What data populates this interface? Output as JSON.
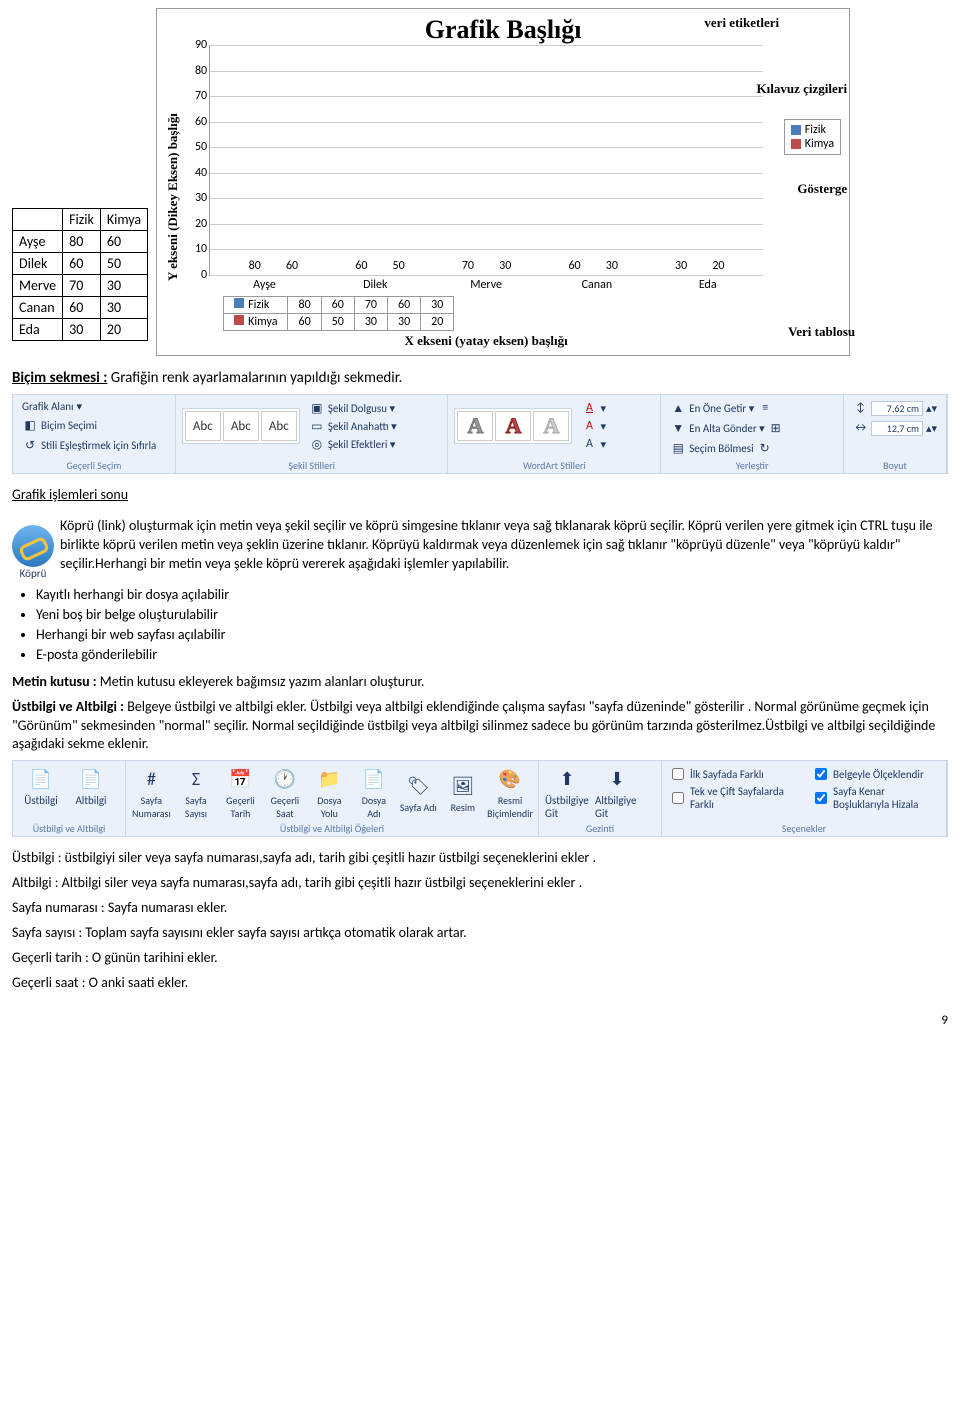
{
  "chart_data": {
    "type": "bar",
    "categories": [
      "Ayşe",
      "Dilek",
      "Merve",
      "Canan",
      "Eda"
    ],
    "series": [
      {
        "name": "Fizik",
        "values": [
          80,
          60,
          70,
          60,
          30
        ]
      },
      {
        "name": "Kimya",
        "values": [
          60,
          50,
          30,
          30,
          20
        ]
      }
    ],
    "title": "Grafik Başlığı",
    "ylabel": "Y ekseni (Dikey Eksen) başlığı",
    "xlabel": "X ekseni (yatay eksen) başlığı",
    "ylim": [
      0,
      90
    ],
    "ticks": [
      0,
      10,
      20,
      30,
      40,
      50,
      60,
      70,
      80,
      90
    ]
  },
  "data_table": {
    "headers": [
      "",
      "Fizik",
      "Kimya"
    ],
    "rows": [
      [
        "Ayşe",
        80,
        60
      ],
      [
        "Dilek",
        60,
        50
      ],
      [
        "Merve",
        70,
        30
      ],
      [
        "Canan",
        60,
        30
      ],
      [
        "Eda",
        30,
        20
      ]
    ]
  },
  "annot": {
    "veri_etiketleri": "veri etiketleri",
    "kilavuz": "Kılavuz çizgileri",
    "gosterge": "Gösterge",
    "veri_tablosu": "Veri tablosu"
  },
  "bicim_heading": "Biçim sekmesi : Grafiğin renk ayarlamalarının yapıldığı sekmedir.",
  "ribbon1": {
    "g1": {
      "name": "Geçerli Seçim",
      "items": [
        "Grafik Alanı",
        "Biçim Seçimi",
        "Stili Eşleştirmek için Sıfırla"
      ]
    },
    "g2": {
      "name": "Şekil Stilleri",
      "abc": "Abc",
      "items": [
        "Şekil Dolgusu ▾",
        "Şekil Anahattı ▾",
        "Şekil Efektleri ▾"
      ]
    },
    "g3": {
      "name": "WordArt Stilleri",
      "a": "A"
    },
    "g4": {
      "name": "Yerleştir",
      "items": [
        "En Öne Getir ▾",
        "En Alta Gönder ▾",
        "Seçim Bölmesi"
      ]
    },
    "g5": {
      "name": "Boyut",
      "h": "7,62 cm",
      "w": "12,7 cm"
    }
  },
  "islem_sonu": "Grafik işlemleri sonu",
  "kopru_label": "Köprü",
  "kopru_text": "Köprü (link) oluşturmak için metin veya şekil seçilir ve köprü simgesine tıklanır veya sağ tıklanarak köprü seçilir. Köprü verilen yere gitmek için CTRL tuşu ile birlikte köprü verilen metin veya şeklin üzerine tıklanır. Köprüyü kaldırmak veya düzenlemek için sağ tıklanır \"köprüyü düzenle\" veya \"köprüyü kaldır\" seçilir.Herhangi bir metin veya şekle köprü vererek aşağıdaki işlemler yapılabilir.",
  "list": [
    "Kayıtlı herhangi bir dosya  açılabilir",
    "Yeni boş bir belge oluşturulabilir",
    "Herhangi bir web sayfası açılabilir",
    "E-posta gönderilebilir"
  ],
  "metin_kutusu": "Metin kutusu : Metin kutusu ekleyerek bağımsız yazım alanları oluşturur.",
  "ustbilgi_alt": "Üstbilgi ve Altbilgi : Belgeye üstbilgi ve altbilgi ekler. Üstbilgi veya altbilgi eklendiğinde çalışma sayfası \"sayfa düzeninde\" gösterilir . Normal görünüme geçmek için \"Görünüm\" sekmesinden \"normal\" seçilir. Normal seçildiğinde üstbilgi veya altbilgi silinmez sadece bu görünüm tarzında gösterilmez.Üstbilgi ve altbilgi seçildiğinde aşağıdaki sekme eklenir.",
  "ribbon2": {
    "g1": {
      "name": "Üstbilgi ve Altbilgi",
      "btns": [
        "Üstbilgi",
        "Altbilgi"
      ]
    },
    "g2": {
      "name": "Üstbilgi ve Altbilgi Öğeleri",
      "btns": [
        "Sayfa Numarası",
        "Sayfa Sayısı",
        "Geçerli Tarih",
        "Geçerli Saat",
        "Dosya Yolu",
        "Dosya Adı",
        "Sayfa Adı",
        "Resim",
        "Resmi Biçimlendir"
      ]
    },
    "g3": {
      "name": "Gezinti",
      "btns": [
        "Üstbilgiye Git",
        "Altbilgiye Git"
      ]
    },
    "g4": {
      "name": "Seçenekler",
      "chk": [
        "İlk Sayfada Farklı",
        "Tek ve Çift Sayfalarda Farklı",
        "Belgeyle Ölçeklendir",
        "Sayfa Kenar Boşluklarıyla Hizala"
      ]
    }
  },
  "defs": {
    "ustbilgi": "Üstbilgi  : üstbilgiyi siler veya sayfa numarası,sayfa adı, tarih gibi çeşitli hazır üstbilgi seçeneklerini ekler .",
    "altbilgi": "Altbilgi : Altbilgi siler veya sayfa numarası,sayfa adı, tarih gibi çeşitli hazır üstbilgi seçeneklerini ekler .",
    "sayfa_num": "Sayfa numarası : Sayfa numarası ekler.",
    "sayfa_say": "Sayfa sayısı : Toplam sayfa sayısını ekler sayfa sayısı artıkça otomatik olarak artar.",
    "tarih": "Geçerli tarih : O günün tarihini ekler.",
    "saat": "Geçerli saat : O anki saati ekler."
  },
  "page_number": "9",
  "bicim_lbl": "Biçim sekmesi :",
  "ust_alt_lbl": "Üstbilgi ve Altbilgi :",
  "metin_lbl": "Metin kutusu :"
}
